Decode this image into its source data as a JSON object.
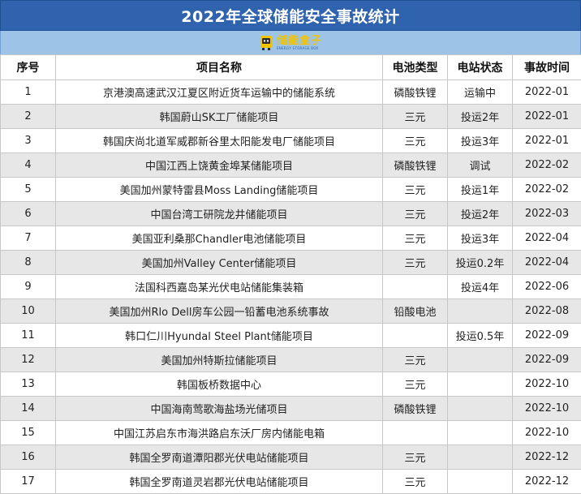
{
  "title": "2022年全球储能安全事故统计",
  "logo": {
    "brand_cn": "储能盒子",
    "brand_en": "ENERGY STORAGE BOX",
    "accent": "#f2c400"
  },
  "table": {
    "headers": [
      "序号",
      "项目名称",
      "电池类型",
      "电站状态",
      "事故时间"
    ],
    "rows": [
      [
        "1",
        "京港澳高速武汉江夏区附近货车运输中的储能系统",
        "磷酸铁锂",
        "运输中",
        "2022-01"
      ],
      [
        "2",
        "韩国蔚山SK工厂储能项目",
        "三元",
        "投运2年",
        "2022-01"
      ],
      [
        "3",
        "韩国庆尚北道军威郡新谷里太阳能发电厂储能项目",
        "三元",
        "投运3年",
        "2022-01"
      ],
      [
        "4",
        "中国江西上饶黄金埠某储能项目",
        "磷酸铁锂",
        "调试",
        "2022-02"
      ],
      [
        "5",
        "美国加州蒙特雷县Moss Landing储能项目",
        "三元",
        "投运1年",
        "2022-02"
      ],
      [
        "6",
        "中国台湾工研院龙井储能项目",
        "三元",
        "投运2年",
        "2022-03"
      ],
      [
        "7",
        "美国亚利桑那Chandler电池储能项目",
        "三元",
        "投运3年",
        "2022-04"
      ],
      [
        "8",
        "美国加州Valley Center储能项目",
        "三元",
        "投运0.2年",
        "2022-04"
      ],
      [
        "9",
        "法国科西嘉岛某光伏电站储能集装箱",
        "",
        "投运4年",
        "2022-06"
      ],
      [
        "10",
        "美国加州Rlo Dell房车公园一铅蓄电池系统事故",
        "铅酸电池",
        "",
        "2022-08"
      ],
      [
        "11",
        "韩口仁川Hyundal Steel Plant储能项目",
        "",
        "投运0.5年",
        "2022-09"
      ],
      [
        "12",
        "美国加州特斯拉储能项目",
        "三元",
        "",
        "2022-09"
      ],
      [
        "13",
        "韩国板桥数据中心",
        "三元",
        "",
        "2022-10"
      ],
      [
        "14",
        "中国海南莺歌海盐场光储项目",
        "磷酸铁锂",
        "",
        "2022-10"
      ],
      [
        "15",
        "中国江苏启东市海洪路启东沃厂房内储能电箱",
        "",
        "",
        "2022-10"
      ],
      [
        "16",
        "韩国全罗南道潭阳郡光伏电站储能项目",
        "三元",
        "",
        "2022-12"
      ],
      [
        "17",
        "韩国全罗南道灵岩郡光伏电站储能项目",
        "三元",
        "",
        "2022-12"
      ]
    ]
  }
}
